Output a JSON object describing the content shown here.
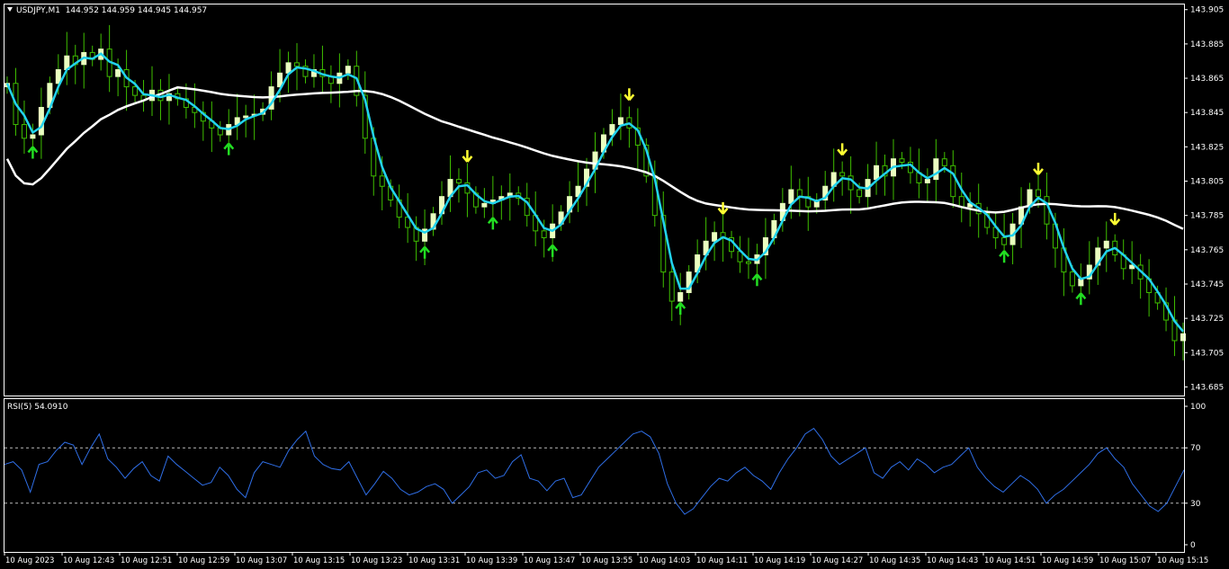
{
  "header": {
    "symbol": "USDJPY,M1",
    "ohlc": "144.952 144.959 144.945 144.957"
  },
  "rsi_header": {
    "label": "RSI(5) 54.0910"
  },
  "colors": {
    "background": "#000000",
    "frame": "#ffffff",
    "bull_candle": "#eaffc0",
    "bear_candle": "#000000",
    "wick": "#3fbf00",
    "ma_fast": "#22d3ee",
    "ma_slow": "#ffffff",
    "rsi_line": "#2f6ee6",
    "arrow_down": "#ffff33",
    "arrow_up": "#22dd22"
  },
  "chart_data": [
    {
      "type": "candlestick",
      "title": "USDJPY,M1",
      "y_axis_ticks": [
        "143.905",
        "143.885",
        "143.865",
        "143.845",
        "143.825",
        "143.805",
        "143.785",
        "143.765",
        "143.745",
        "143.725",
        "143.705",
        "143.685"
      ],
      "ylim": [
        143.68,
        143.908
      ],
      "x_axis_ticks": [
        "10 Aug 2023",
        "10 Aug 12:43",
        "10 Aug 12:51",
        "10 Aug 12:59",
        "10 Aug 13:07",
        "10 Aug 13:15",
        "10 Aug 13:23",
        "10 Aug 13:31",
        "10 Aug 13:39",
        "10 Aug 13:47",
        "10 Aug 13:55",
        "10 Aug 14:03",
        "10 Aug 14:11",
        "10 Aug 14:19",
        "10 Aug 14:27",
        "10 Aug 14:35",
        "10 Aug 14:43",
        "10 Aug 14:51",
        "10 Aug 14:59",
        "10 Aug 15:07",
        "10 Aug 15:15"
      ],
      "close": [
        143.862,
        143.838,
        143.83,
        143.832,
        143.848,
        143.862,
        143.87,
        143.878,
        143.873,
        143.88,
        143.876,
        143.882,
        143.866,
        143.87,
        143.86,
        143.855,
        143.852,
        143.858,
        143.852,
        143.856,
        143.853,
        143.848,
        143.845,
        143.84,
        143.836,
        143.832,
        143.838,
        143.842,
        143.843,
        143.844,
        143.847,
        143.86,
        143.868,
        143.874,
        143.872,
        143.866,
        143.87,
        143.866,
        143.862,
        143.868,
        143.872,
        143.855,
        143.83,
        143.808,
        143.802,
        143.794,
        143.784,
        143.778,
        143.77,
        143.777,
        143.786,
        143.796,
        143.806,
        143.804,
        143.798,
        143.79,
        143.792,
        143.794,
        143.796,
        143.798,
        143.795,
        143.785,
        143.776,
        143.772,
        143.78,
        143.787,
        143.796,
        143.802,
        143.812,
        143.822,
        143.832,
        143.838,
        143.842,
        143.836,
        143.826,
        143.808,
        143.785,
        143.752,
        143.735,
        143.74,
        143.752,
        143.762,
        143.77,
        143.775,
        143.772,
        143.764,
        143.758,
        143.757,
        143.762,
        143.772,
        143.782,
        143.792,
        143.8,
        143.796,
        143.79,
        143.794,
        143.802,
        143.81,
        143.808,
        143.8,
        143.796,
        143.806,
        143.814,
        143.808,
        143.818,
        143.816,
        143.81,
        143.804,
        143.806,
        143.818,
        143.814,
        143.796,
        143.79,
        143.792,
        143.786,
        143.778,
        143.772,
        143.768,
        143.78,
        143.79,
        143.8,
        143.796,
        143.78,
        143.766,
        143.752,
        143.744,
        143.748,
        143.756,
        143.766,
        143.77,
        143.762,
        143.754,
        143.756,
        143.748,
        143.74,
        143.734,
        143.724,
        143.712,
        143.716
      ]
    },
    {
      "type": "line",
      "title": "RSI(5) 54.0910",
      "y_axis_ticks": [
        "100",
        "70",
        "30",
        "0"
      ],
      "ylim": [
        0,
        100
      ],
      "levels": [
        70,
        30
      ],
      "values": [
        58,
        60,
        54,
        38,
        58,
        60,
        68,
        74,
        72,
        58,
        70,
        80,
        62,
        56,
        48,
        55,
        60,
        50,
        46,
        64,
        58,
        53,
        48,
        43,
        45,
        56,
        50,
        40,
        34,
        52,
        60,
        58,
        56,
        68,
        76,
        82,
        64,
        58,
        55,
        54,
        60,
        48,
        36,
        44,
        53,
        48,
        40,
        36,
        38,
        42,
        44,
        40,
        30,
        36,
        42,
        52,
        54,
        48,
        50,
        60,
        65,
        48,
        46,
        39,
        46,
        48,
        34,
        36,
        46,
        56,
        62,
        68,
        74,
        80,
        82,
        78,
        66,
        44,
        30,
        22,
        26,
        34,
        42,
        48,
        46,
        52,
        56,
        50,
        46,
        40,
        52,
        62,
        70,
        80,
        84,
        76,
        64,
        58,
        62,
        66,
        70,
        52,
        48,
        56,
        60,
        54,
        62,
        58,
        52,
        56,
        58,
        64,
        70,
        56,
        48,
        42,
        38,
        44,
        50,
        46,
        40,
        30,
        36,
        40,
        46,
        52,
        58,
        66,
        70,
        62,
        56,
        44,
        36,
        28,
        24,
        30,
        42,
        54
      ]
    }
  ]
}
